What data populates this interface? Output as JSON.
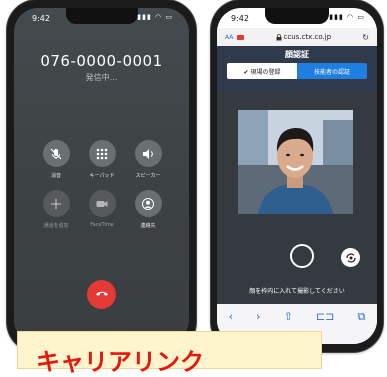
{
  "left_phone": {
    "status_time": "9:42",
    "phone_number": "076-0000-0001",
    "call_status": "発信中...",
    "buttons": [
      {
        "label": "消音",
        "icon": "mute-icon"
      },
      {
        "label": "キーパッド",
        "icon": "keypad-icon"
      },
      {
        "label": "スピーカー",
        "icon": "speaker-icon"
      },
      {
        "label": "通話を追加",
        "icon": "add-call-icon"
      },
      {
        "label": "FaceTime",
        "icon": "facetime-icon"
      },
      {
        "label": "連絡先",
        "icon": "contacts-icon"
      }
    ],
    "end_call_icon": "end-call-icon"
  },
  "right_phone": {
    "status_time": "9:42",
    "browser": {
      "aa_label": "AA",
      "url": "ccus.ctx.co.jp",
      "reload_icon": "reload-icon"
    },
    "page_title": "顔認証",
    "segments": [
      {
        "label": "✔ 現場の登録",
        "selected": false
      },
      {
        "label": "技能者の認証",
        "selected": true
      }
    ],
    "instruction": "顔を枠内に入れて撮影してください",
    "toolbar_icons": [
      "back-icon",
      "forward-icon",
      "share-icon",
      "bookmarks-icon",
      "tabs-icon"
    ]
  },
  "caption": {
    "text": "キャリアリンク"
  },
  "colors": {
    "header_bg": "#2f3b4c",
    "segment_active": "#1f7fe0",
    "end_call": "#e53935",
    "caption_text": "#e5170f",
    "caption_bg": "#fff4cc"
  }
}
